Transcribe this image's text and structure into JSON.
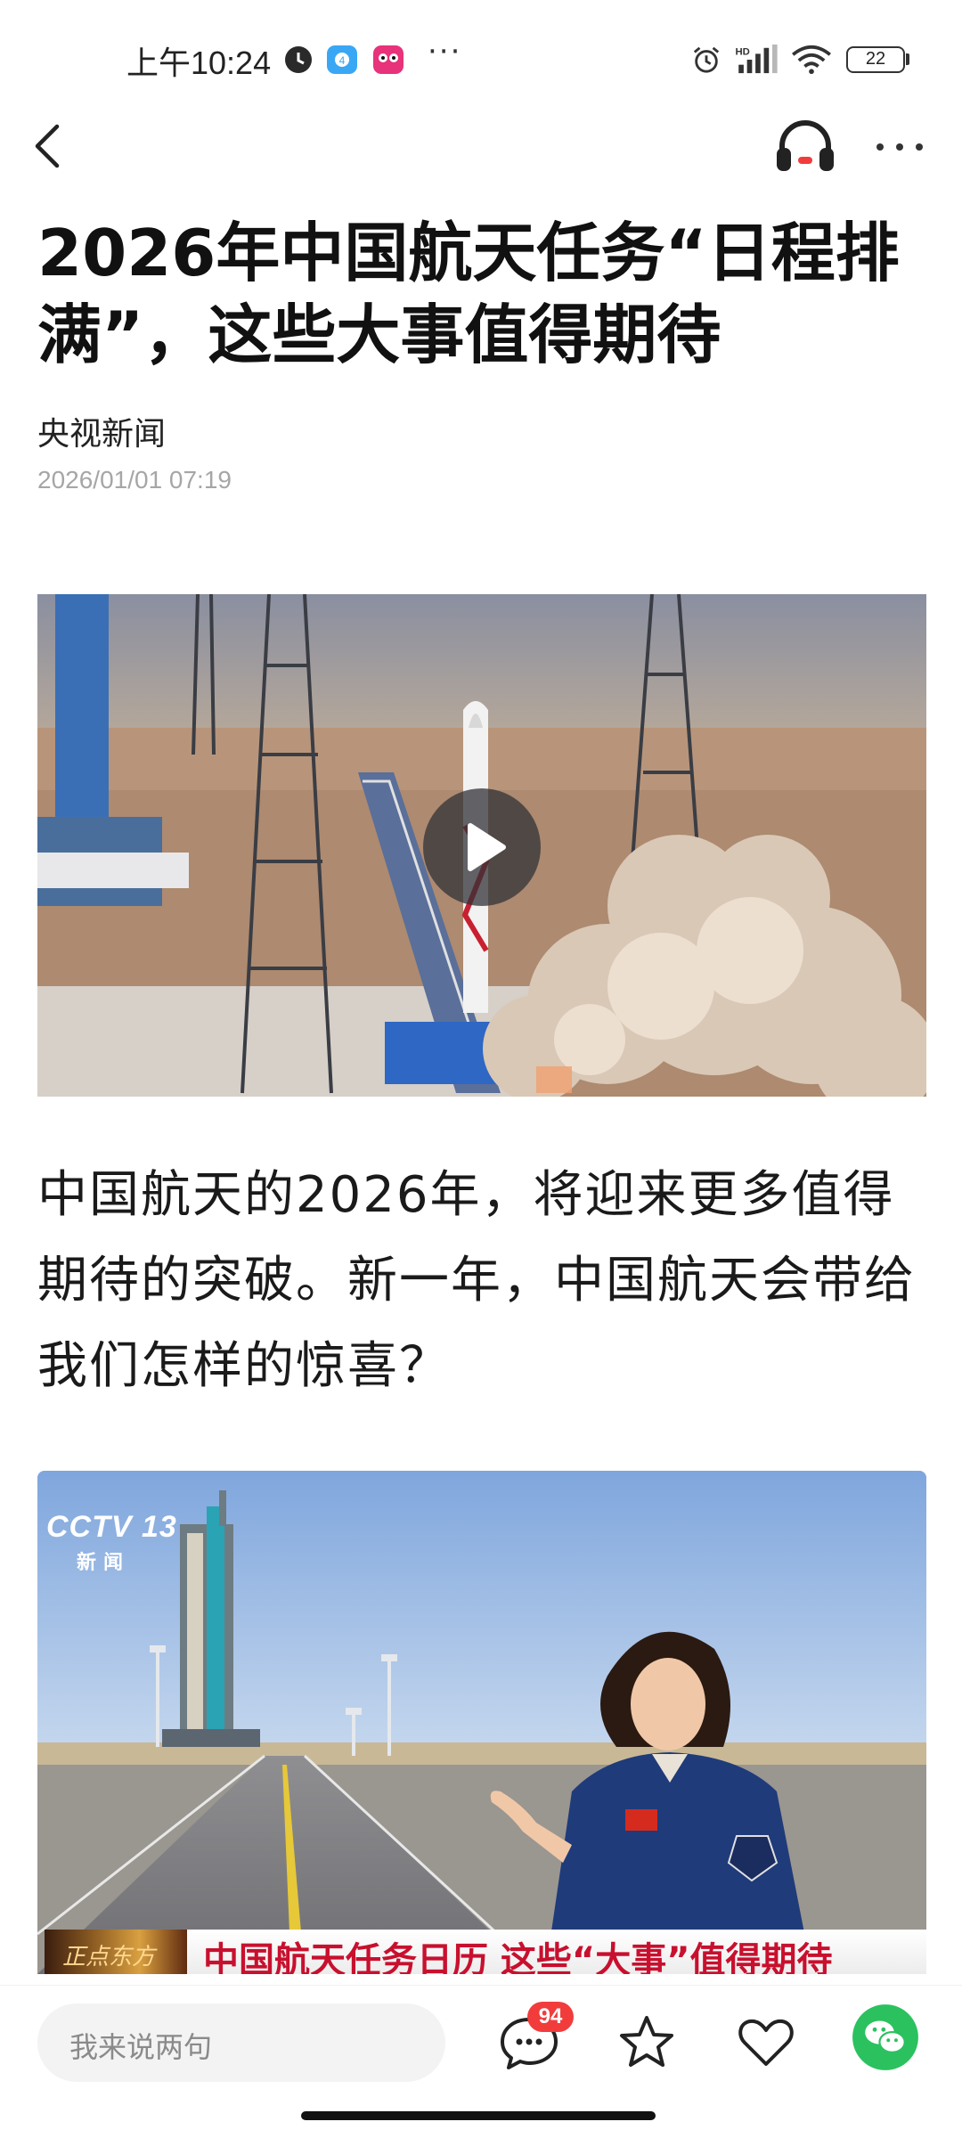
{
  "status_bar": {
    "time": "上午10:24",
    "icons": [
      "clock-app-icon",
      "cloud-app-icon",
      "game-app-icon",
      "more-notifications-icon",
      "alarm-icon",
      "hd-signal-icon",
      "wifi-icon",
      "battery-icon"
    ],
    "battery_level": "22"
  },
  "nav": {
    "back_icon": "chevron-left-icon",
    "listen_icon": "headphones-icon",
    "more_icon": "more-dots-icon"
  },
  "article": {
    "title": "2026年中国航天任务“日程排满”，这些大事值得期待",
    "source": "央视新闻",
    "published": "2026/01/01 07:19",
    "paragraph": "中国航天的2026年，将迎来更多值得期待的突破。新一年，中国航天会带给我们怎样的惊喜？"
  },
  "video2": {
    "channel_logo": "CCTV 13",
    "channel_sub": "新闻",
    "program_logo": "正点东方",
    "caption": "中国航天任务日历 这些“大事”值得期待"
  },
  "bottom_bar": {
    "comment_placeholder": "我来说两句",
    "comment_count": "94",
    "icons": [
      "comment-icon",
      "star-icon",
      "heart-icon",
      "wechat-share-icon"
    ]
  },
  "colors": {
    "accent_red": "#f23c3c",
    "wechat_green": "#2bc15f",
    "caption_red": "#c8102e",
    "muted_text": "#a6a6a6"
  }
}
